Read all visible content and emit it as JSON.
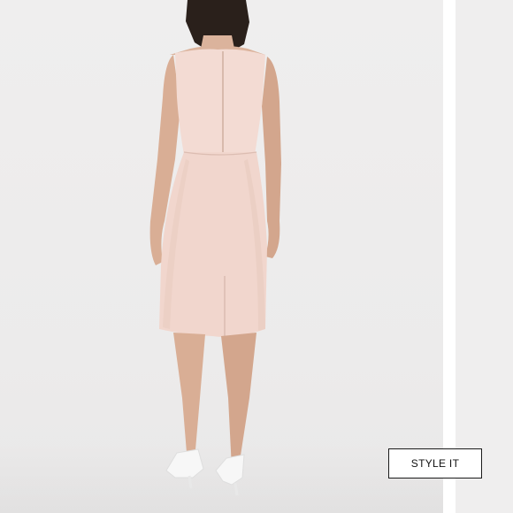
{
  "product_image": {
    "description_icon": "model-back-view-photo"
  },
  "style_it_button": {
    "label": "STYLE IT"
  },
  "colors": {
    "dress": "#f2d9d1",
    "background": "#efeeee",
    "shoes": "#f7f7f7",
    "button_border": "#1a1a1a"
  }
}
